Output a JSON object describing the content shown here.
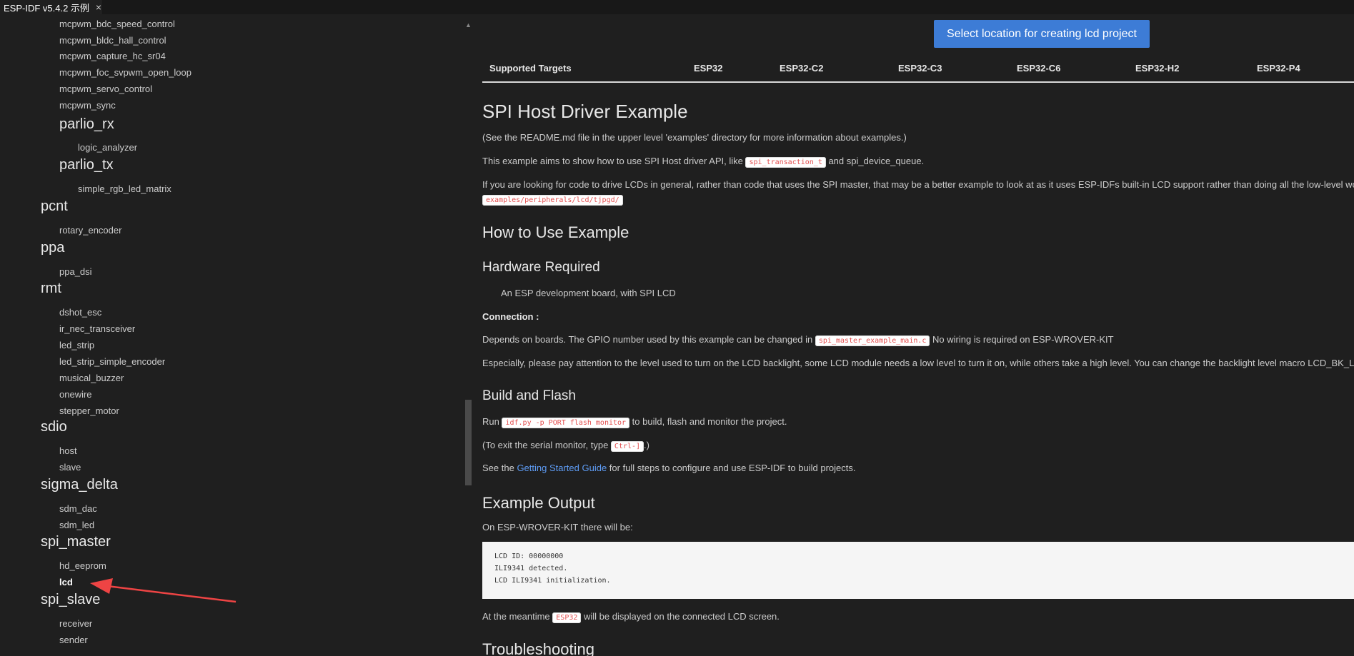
{
  "tab": {
    "title": "ESP-IDF v5.4.2 示例",
    "close_icon": "×"
  },
  "tree": {
    "top_items": [
      "mcpwm_bdc_speed_control",
      "mcpwm_bldc_hall_control",
      "mcpwm_capture_hc_sr04",
      "mcpwm_foc_svpwm_open_loop",
      "mcpwm_servo_control",
      "mcpwm_sync"
    ],
    "parlio_rx": "parlio_rx",
    "logic_analyzer": "logic_analyzer",
    "parlio_tx": "parlio_tx",
    "simple_rgb_led_matrix": "simple_rgb_led_matrix",
    "pcnt": "pcnt",
    "rotary_encoder": "rotary_encoder",
    "ppa": "ppa",
    "ppa_dsi": "ppa_dsi",
    "rmt": "rmt",
    "rmt_items": [
      "dshot_esc",
      "ir_nec_transceiver",
      "led_strip",
      "led_strip_simple_encoder",
      "musical_buzzer",
      "onewire",
      "stepper_motor"
    ],
    "sdio": "sdio",
    "sdio_items": [
      "host",
      "slave"
    ],
    "sigma_delta": "sigma_delta",
    "sigma_items": [
      "sdm_dac",
      "sdm_led"
    ],
    "spi_master": "spi_master",
    "spi_master_items": [
      "hd_eeprom",
      "lcd"
    ],
    "spi_slave": "spi_slave",
    "spi_slave_items": [
      "receiver",
      "sender"
    ]
  },
  "content": {
    "create_button": "Select location for creating lcd project",
    "targets": [
      "Supported Targets",
      "ESP32",
      "ESP32-C2",
      "ESP32-C3",
      "ESP32-C6",
      "ESP32-H2",
      "ESP32-P4"
    ],
    "title": "SPI Host Driver Example",
    "p1": "(See the README.md file in the upper level 'examples' directory for more information about examples.)",
    "p2_pre": "This example aims to show how to use SPI Host driver API, like ",
    "p2_code": "spi_transaction_t",
    "p2_post": " and spi_device_queue.",
    "p3": "If you are looking for code to drive LCDs in general, rather than code that uses the SPI master, that may be a better example to look at as it uses ESP-IDFs built-in LCD support rather than doing all the low-level wor",
    "p3_code": "examples/peripherals/lcd/tjpgd/",
    "h_how": "How to Use Example",
    "h_hw": "Hardware Required",
    "hw_item": "An ESP development board, with SPI LCD",
    "connection": "Connection :",
    "p4_pre": "Depends on boards. The GPIO number used by this example can be changed in ",
    "p4_code": "spi_master_example_main.c",
    "p4_post": " No wiring is required on ESP-WROVER-KIT",
    "p5": "Especially, please pay attention to the level used to turn on the LCD backlight, some LCD module needs a low level to turn it on, while others take a high level. You can change the backlight level macro LCD_BK_LIGH",
    "h_build": "Build and Flash",
    "p6_pre": "Run ",
    "p6_code": "idf.py -p PORT flash monitor",
    "p6_post": " to build, flash and monitor the project.",
    "p7_pre": "(To exit the serial monitor, type ",
    "p7_code": "Ctrl-]",
    "p7_post": ".)",
    "p8_pre": "See the ",
    "p8_link": "Getting Started Guide",
    "p8_post": " for full steps to configure and use ESP-IDF to build projects.",
    "h_output": "Example Output",
    "p9": "On ESP-WROVER-KIT there will be:",
    "pre_lines": [
      "LCD ID: 00000000",
      "ILI9341 detected.",
      "LCD ILI9341 initialization."
    ],
    "p10_pre": "At the meantime ",
    "p10_code": "ESP32",
    "p10_post": " will be displayed on the connected LCD screen.",
    "h_trouble": "Troubleshooting"
  }
}
